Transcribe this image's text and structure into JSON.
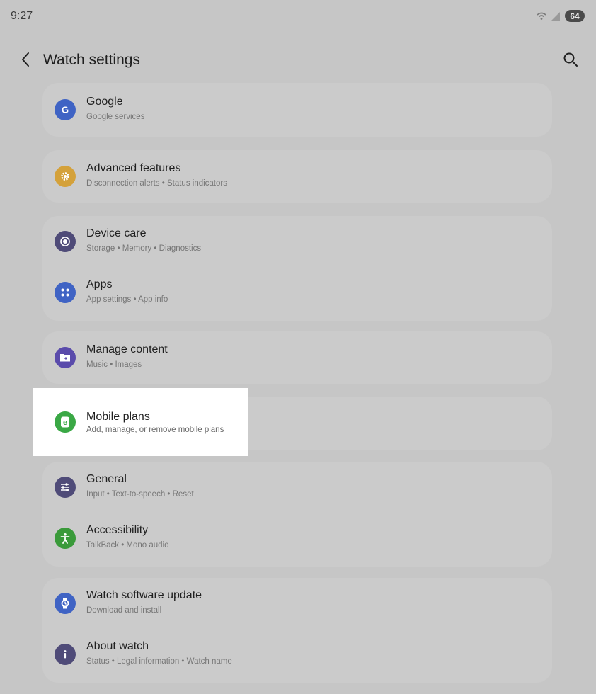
{
  "status_bar": {
    "time": "9:27",
    "battery": "64"
  },
  "header": {
    "title": "Watch settings",
    "back_icon": "chevron-left-icon",
    "search_icon": "search-icon"
  },
  "groups": [
    {
      "items": [
        {
          "title": "Google",
          "subtitle": "Google services",
          "icon": "google-icon",
          "color": "#3f63c4"
        }
      ]
    },
    {
      "items": [
        {
          "title": "Advanced features",
          "subtitle": "Disconnection alerts • Status indicators",
          "icon": "gear-icon",
          "color": "#d4a13a"
        }
      ]
    },
    {
      "items": [
        {
          "title": "Device care",
          "subtitle": "Storage • Memory • Diagnostics",
          "icon": "device-care-icon",
          "color": "#4f4b78"
        },
        {
          "title": "Apps",
          "subtitle": "App settings • App info",
          "icon": "apps-icon",
          "color": "#3f63c4"
        }
      ]
    },
    {
      "items": [
        {
          "title": "Manage content",
          "subtitle": "Music • Images",
          "icon": "folder-icon",
          "color": "#5a4bab"
        }
      ]
    },
    {
      "items": [
        {
          "title": "Mobile plans",
          "subtitle": "Add, manage, or remove mobile plans",
          "icon": "esim-icon",
          "color": "#3aa845"
        }
      ]
    },
    {
      "items": [
        {
          "title": "General",
          "subtitle": "Input • Text-to-speech • Reset",
          "icon": "sliders-icon",
          "color": "#4f4b78"
        },
        {
          "title": "Accessibility",
          "subtitle": "TalkBack • Mono audio",
          "icon": "accessibility-icon",
          "color": "#3a9a3a"
        }
      ]
    },
    {
      "items": [
        {
          "title": "Watch software update",
          "subtitle": "Download and install",
          "icon": "watch-update-icon",
          "color": "#3f63c4"
        },
        {
          "title": "About watch",
          "subtitle": "Status • Legal information • Watch name",
          "icon": "info-icon",
          "color": "#4f4b78"
        }
      ]
    }
  ]
}
